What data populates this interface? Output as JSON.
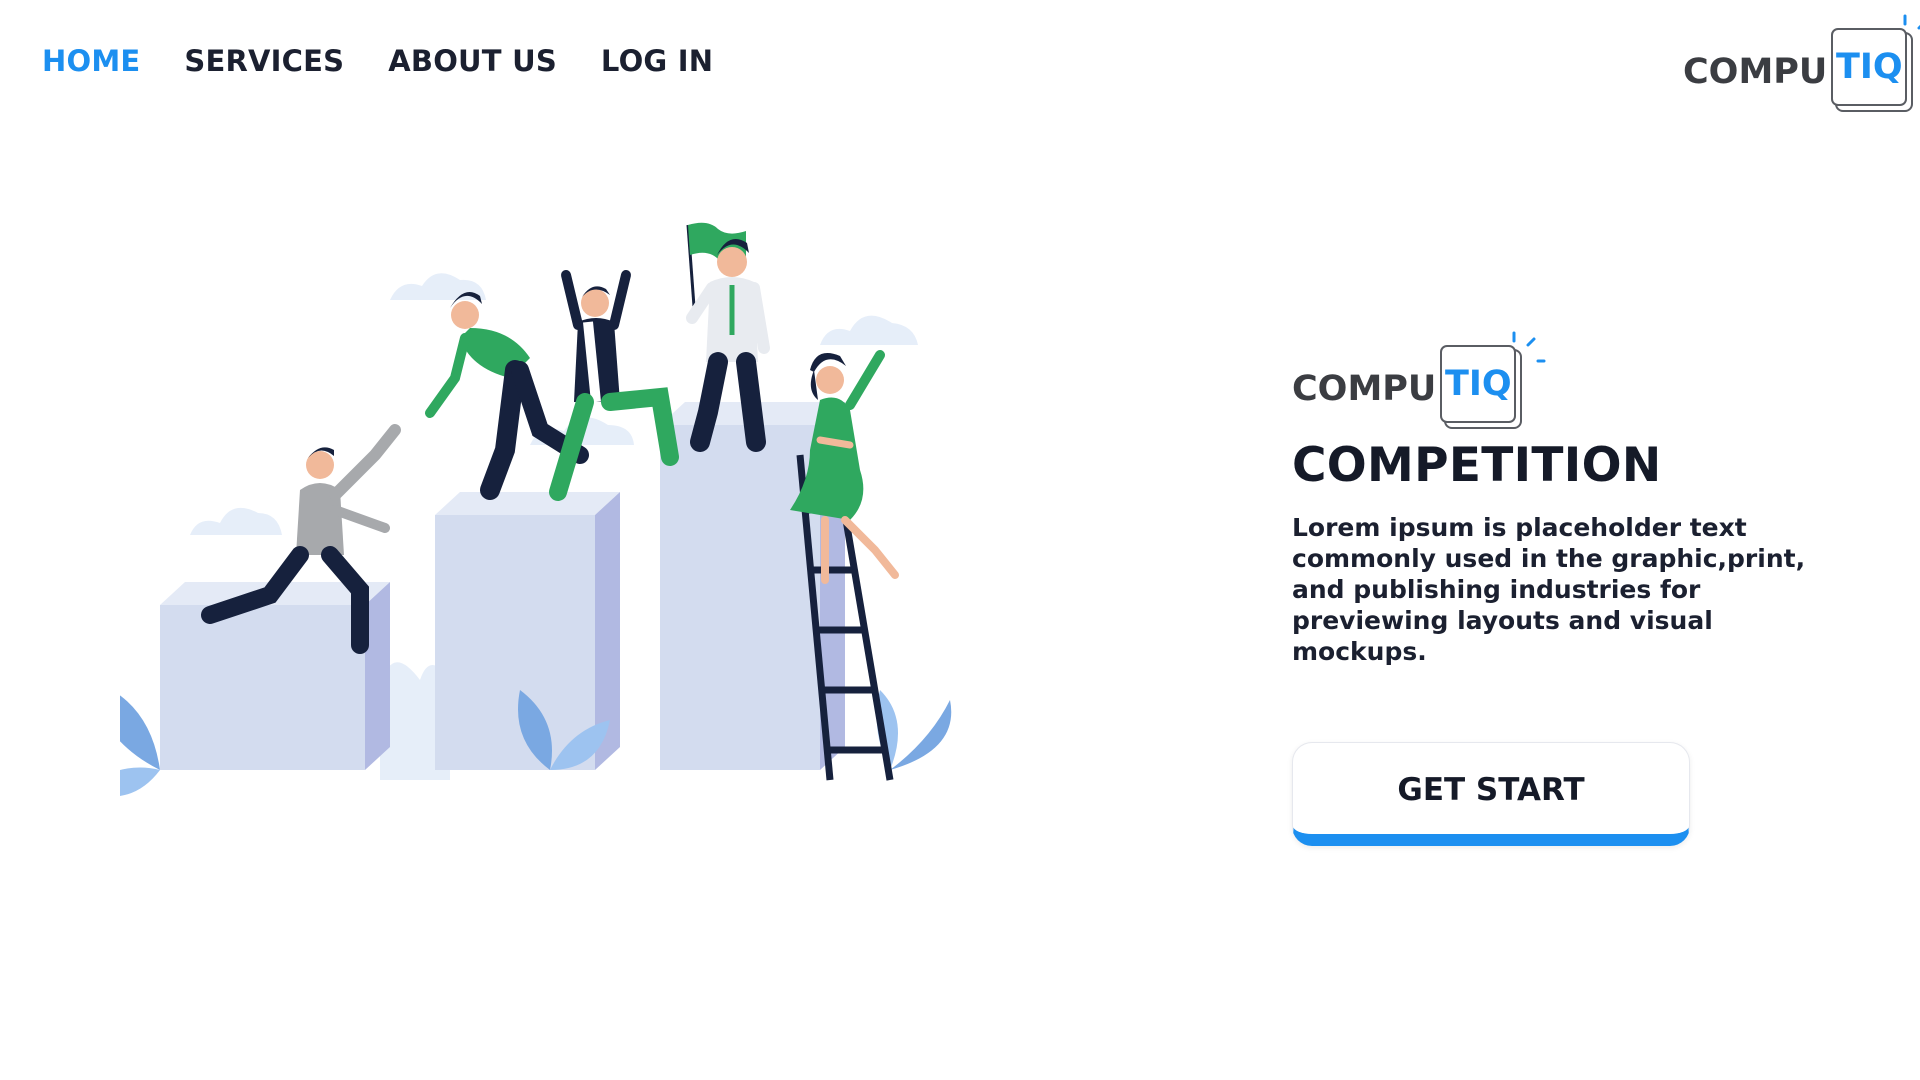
{
  "nav": {
    "items": [
      {
        "label": "HOME",
        "active": true
      },
      {
        "label": "SERVICES",
        "active": false
      },
      {
        "label": "ABOUT US",
        "active": false
      },
      {
        "label": "LOG IN",
        "active": false
      }
    ]
  },
  "logo": {
    "part1": "COMPU",
    "part2": "TIQ"
  },
  "hero": {
    "title": "COMPETITION",
    "description": "Lorem ipsum is placeholder text commonly used in the graphic,print, and publishing industries for previewing layouts and visual mockups.",
    "cta_label": "GET START"
  },
  "colors": {
    "accent": "#1c8ff0",
    "text": "#1b2030",
    "illustration_green": "#2fa85f",
    "illustration_navy": "#16213d",
    "illustration_block": "#d3dcef"
  },
  "illustration": {
    "subject": "team-climbing-podium-icon"
  }
}
